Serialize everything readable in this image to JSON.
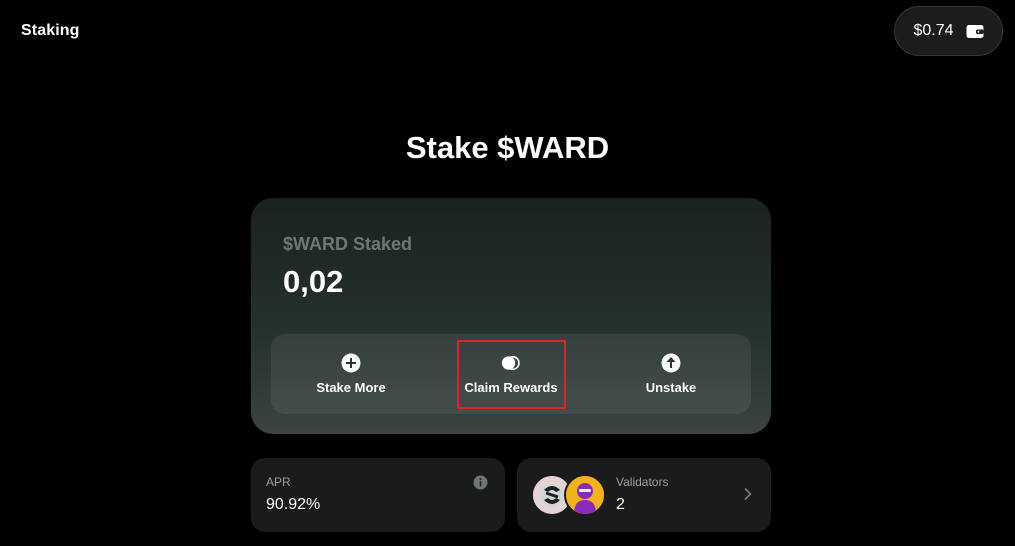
{
  "header": {
    "title": "Staking",
    "wallet_balance": "$0.74",
    "wallet_icon": "wallet-icon"
  },
  "page": {
    "title": "Stake $WARD"
  },
  "stake_card": {
    "label": "$WARD Staked",
    "value": "0,02",
    "actions": [
      {
        "label": "Stake More",
        "icon": "plus-circle-icon"
      },
      {
        "label": "Claim Rewards",
        "icon": "coins-icon"
      },
      {
        "label": "Unstake",
        "icon": "arrow-up-circle-icon"
      }
    ]
  },
  "apr": {
    "label": "APR",
    "value": "90.92%",
    "icon": "info-icon"
  },
  "validators": {
    "label": "Validators",
    "value": "2",
    "icon": "chevron-right-icon"
  },
  "colors": {
    "background": "#000000",
    "highlight": "#e02424",
    "avatar_2": "#f1b21a",
    "avatar_2_figure": "#8a2ab8"
  }
}
